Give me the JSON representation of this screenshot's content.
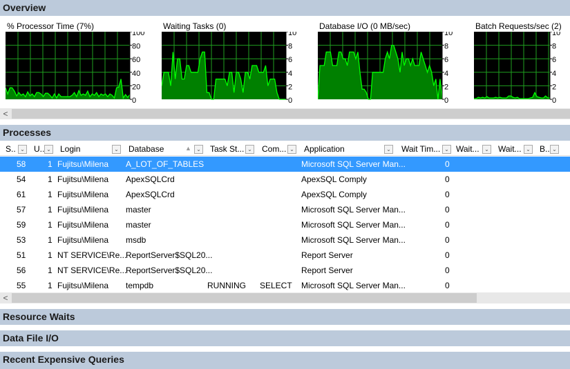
{
  "sections": {
    "overview": "Overview",
    "processes": "Processes",
    "resource_waits": "Resource Waits",
    "data_file_io": "Data File I/O",
    "recent_queries": "Recent Expensive Queries"
  },
  "charts": [
    {
      "title": "% Processor Time (7%)",
      "ymax": 100,
      "ticks": [
        "100",
        "80",
        "60",
        "40",
        "20",
        "0"
      ],
      "values": [
        17,
        8,
        17,
        17,
        12,
        5,
        10,
        6,
        8,
        4,
        11,
        5,
        8,
        4,
        10,
        10,
        8,
        4,
        9,
        9,
        6,
        2,
        8,
        2,
        8,
        4,
        4,
        4,
        4,
        4,
        6,
        10,
        4,
        13,
        6,
        8,
        6,
        12,
        4,
        8,
        6,
        10,
        4,
        8,
        6,
        8,
        4,
        8,
        6,
        2,
        17,
        18,
        30,
        2,
        7,
        3,
        7
      ]
    },
    {
      "title": "Waiting Tasks (0)",
      "ymax": 10,
      "ticks": [
        "10",
        "8",
        "6",
        "4",
        "2",
        "0"
      ],
      "values": [
        2,
        4,
        4,
        4,
        2,
        7,
        3,
        6,
        6,
        3,
        3,
        5,
        5,
        4,
        4,
        4,
        4,
        6,
        7,
        7,
        1,
        1,
        0,
        0,
        3,
        3,
        3,
        3,
        3,
        2,
        4,
        4,
        1,
        4,
        4,
        3,
        1,
        4,
        4,
        3,
        5,
        5,
        5,
        4,
        4,
        4,
        5,
        2,
        3,
        3,
        3,
        1,
        0,
        0,
        0,
        0
      ]
    },
    {
      "title": "Database I/O (0 MB/sec)",
      "ymax": 10,
      "ticks": [
        "10",
        "8",
        "6",
        "4",
        "2",
        "0"
      ],
      "values": [
        0,
        5,
        5,
        5,
        7,
        7,
        7,
        5,
        5,
        5,
        7,
        7,
        6,
        6,
        5,
        7,
        7,
        7,
        6,
        7,
        4,
        1.5,
        1.5,
        1,
        0,
        0,
        4,
        4,
        4,
        4,
        4,
        4,
        6,
        7,
        6,
        8,
        8,
        7,
        6,
        4,
        7,
        5,
        6,
        6,
        5,
        6,
        5,
        5,
        5,
        7,
        6,
        5,
        4,
        5,
        4,
        2,
        3,
        0,
        3,
        0
      ]
    },
    {
      "title": "Batch Requests/sec (2)",
      "ymax": 10,
      "ticks": [
        "10",
        "8",
        "6",
        "4",
        "2",
        "0"
      ],
      "values": [
        0.1,
        0.1,
        0.3,
        0.2,
        0.3,
        0.2,
        0.4,
        0.2,
        0.2,
        0.2,
        0.3,
        0.2,
        0.3,
        0.2,
        0.2,
        0.2,
        0.5,
        0.5,
        0.3,
        0.2,
        0.3,
        0.1,
        0.1,
        0.1,
        0.1,
        0.1,
        0.2,
        0.3,
        1,
        0.4,
        0.3,
        0.2,
        0.2,
        0.5,
        0.2,
        0.2
      ]
    }
  ],
  "colors": {
    "chart_bg": "#000000",
    "grid": "#1f9f1f",
    "line": "#00ff00",
    "fill": "#008000",
    "selected": "#3399ff",
    "section": "#bccadb"
  },
  "columns": [
    "S..",
    "U..",
    "Login",
    "Database",
    "Task St...",
    "Com...",
    "Application",
    "Wait Tim...",
    "Wait...",
    "Wait...",
    "B...",
    ""
  ],
  "rows": [
    {
      "s": "58",
      "u": "1",
      "login": "Fujitsu\\Milena",
      "db": "A_LOT_OF_TABLES",
      "task": "",
      "cmd": "",
      "app": "Microsoft SQL Server Man...",
      "wait": "0",
      "selected": true
    },
    {
      "s": "54",
      "u": "1",
      "login": "Fujitsu\\Milena",
      "db": "ApexSQLCrd",
      "task": "",
      "cmd": "",
      "app": "ApexSQL Comply",
      "wait": "0"
    },
    {
      "s": "61",
      "u": "1",
      "login": "Fujitsu\\Milena",
      "db": "ApexSQLCrd",
      "task": "",
      "cmd": "",
      "app": "ApexSQL Comply",
      "wait": "0"
    },
    {
      "s": "57",
      "u": "1",
      "login": "Fujitsu\\Milena",
      "db": "master",
      "task": "",
      "cmd": "",
      "app": "Microsoft SQL Server Man...",
      "wait": "0"
    },
    {
      "s": "59",
      "u": "1",
      "login": "Fujitsu\\Milena",
      "db": "master",
      "task": "",
      "cmd": "",
      "app": "Microsoft SQL Server Man...",
      "wait": "0"
    },
    {
      "s": "53",
      "u": "1",
      "login": "Fujitsu\\Milena",
      "db": "msdb",
      "task": "",
      "cmd": "",
      "app": "Microsoft SQL Server Man...",
      "wait": "0"
    },
    {
      "s": "51",
      "u": "1",
      "login": "NT SERVICE\\Re...",
      "db": "ReportServer$SQL20...",
      "task": "",
      "cmd": "",
      "app": "Report Server",
      "wait": "0"
    },
    {
      "s": "56",
      "u": "1",
      "login": "NT SERVICE\\Re...",
      "db": "ReportServer$SQL20...",
      "task": "",
      "cmd": "",
      "app": "Report Server",
      "wait": "0"
    },
    {
      "s": "55",
      "u": "1",
      "login": "Fujitsu\\Milena",
      "db": "tempdb",
      "task": "RUNNING",
      "cmd": "SELECT",
      "app": "Microsoft SQL Server Man...",
      "wait": "0"
    }
  ]
}
